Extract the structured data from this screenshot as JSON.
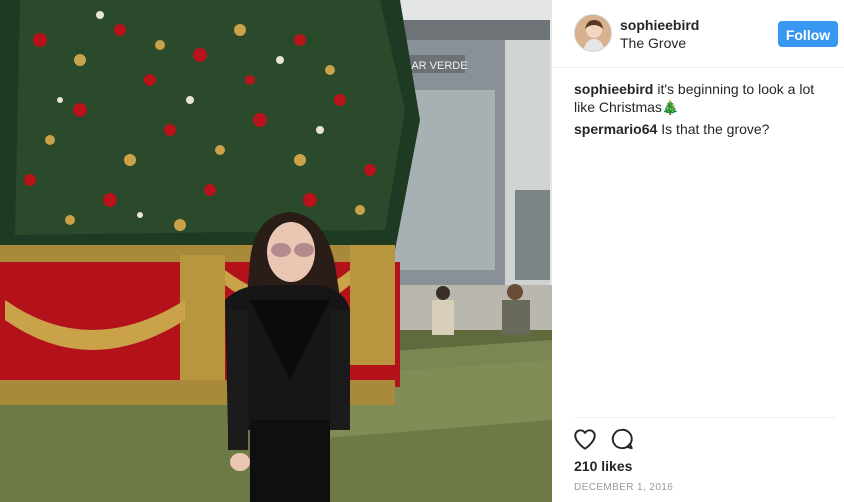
{
  "post": {
    "image_alt": "Woman in sunglasses and black leather jacket standing in front of a decorated Christmas tree at The Grove",
    "storefront_sign": "BAR VERDE"
  },
  "header": {
    "username": "sophieebird",
    "location": "The Grove",
    "follow_label": "Follow",
    "follow_color": "#3897f0"
  },
  "comments": [
    {
      "author": "sophieebird",
      "text": "it's beginning to look a lot like Christmas🎄"
    },
    {
      "author": "spermario64",
      "text": "Is that the grove?"
    }
  ],
  "actions": {
    "like_icon": "heart-icon",
    "comment_icon": "comment-bubble-icon"
  },
  "likes": "210 likes",
  "date": "DECEMBER 1, 2016"
}
